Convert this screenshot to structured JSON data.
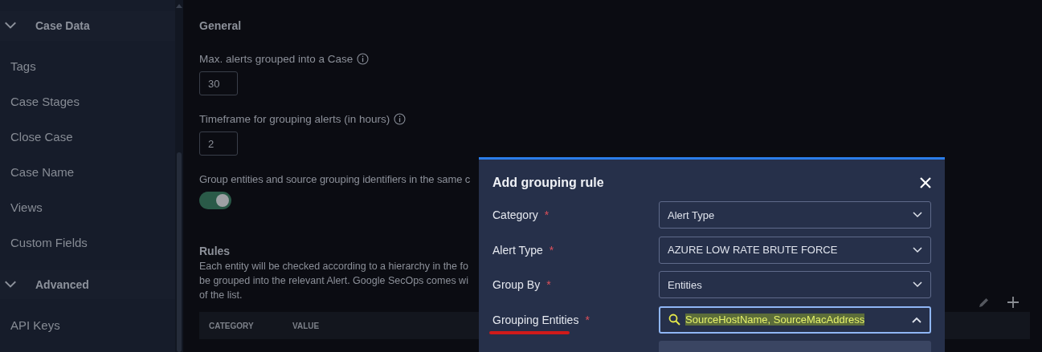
{
  "sidebar": {
    "sections": [
      {
        "title": "Case Data",
        "expanded": true,
        "items": [
          "Tags",
          "Case Stages",
          "Close Case",
          "Case Name",
          "Views",
          "Custom Fields"
        ]
      },
      {
        "title": "Advanced",
        "expanded": true,
        "items": [
          "API Keys"
        ]
      }
    ]
  },
  "main": {
    "heading": "General",
    "fields": [
      {
        "label": "Max. alerts grouped into a Case",
        "value": "30"
      },
      {
        "label": "Timeframe for grouping alerts (in hours)",
        "value": "2"
      }
    ],
    "toggle": {
      "label": "Group entities and source grouping identifiers in the same c",
      "on": true
    },
    "rules": {
      "title": "Rules",
      "description_lines": [
        "Each entity will be checked according to a hierarchy in the fo",
        "be grouped into the relevant Alert. Google SecOps comes wi",
        "of the list."
      ],
      "columns": [
        "CATEGORY",
        "VALUE"
      ]
    }
  },
  "dialog": {
    "title": "Add grouping rule",
    "fields": [
      {
        "label": "Category",
        "required": "*",
        "value": "Alert Type",
        "kind": "select",
        "expanded": false
      },
      {
        "label": "Alert Type",
        "required": "*",
        "value": "AZURE LOW RATE BRUTE FORCE",
        "kind": "select",
        "expanded": false
      },
      {
        "label": "Group By",
        "required": "*",
        "value": "Entities",
        "kind": "select",
        "expanded": false
      },
      {
        "label": "Grouping Entities",
        "required": "*",
        "value": "SourceHostName, SourceMacAddress",
        "kind": "search",
        "expanded": true,
        "highlighted": true,
        "underlined": true
      }
    ]
  }
}
